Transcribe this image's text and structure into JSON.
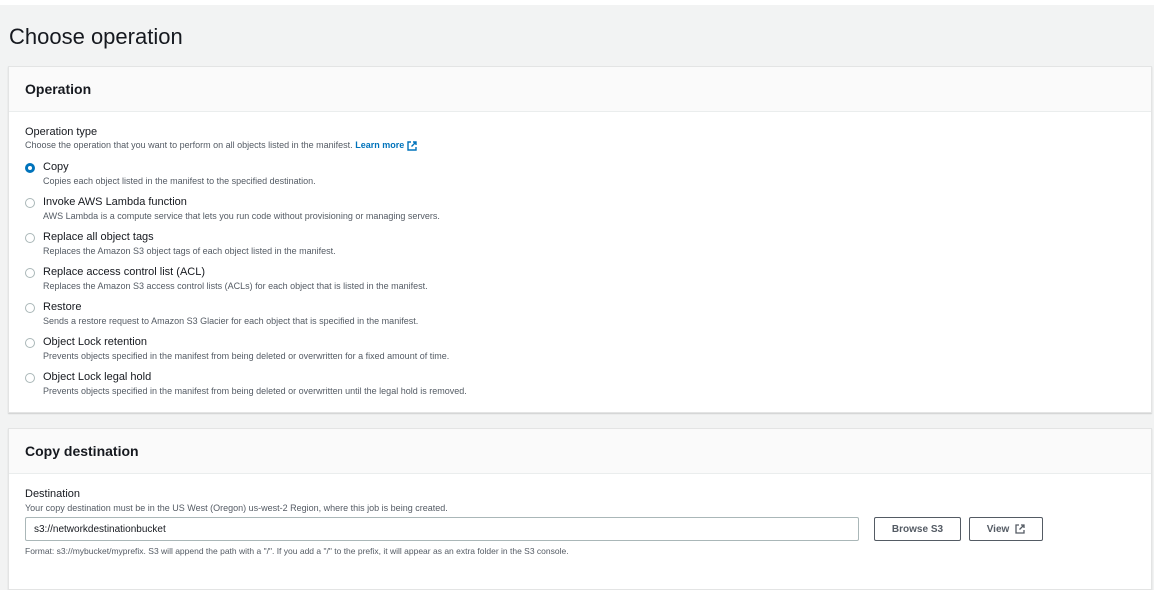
{
  "page": {
    "title": "Choose operation"
  },
  "operation": {
    "header": "Operation",
    "type_label": "Operation type",
    "type_desc": "Choose the operation that you want to perform on all objects listed in the manifest.",
    "learn_more": "Learn more",
    "selected": "copy",
    "options": [
      {
        "id": "copy",
        "label": "Copy",
        "desc": "Copies each object listed in the manifest to the specified destination."
      },
      {
        "id": "lambda",
        "label": "Invoke AWS Lambda function",
        "desc": "AWS Lambda is a compute service that lets you run code without provisioning or managing servers."
      },
      {
        "id": "tags",
        "label": "Replace all object tags",
        "desc": "Replaces the Amazon S3 object tags of each object listed in the manifest."
      },
      {
        "id": "acl",
        "label": "Replace access control list (ACL)",
        "desc": "Replaces the Amazon S3 access control lists (ACLs) for each object that is listed in the manifest."
      },
      {
        "id": "restore",
        "label": "Restore",
        "desc": "Sends a restore request to Amazon S3 Glacier for each object that is specified in the manifest."
      },
      {
        "id": "retention",
        "label": "Object Lock retention",
        "desc": "Prevents objects specified in the manifest from being deleted or overwritten for a fixed amount of time."
      },
      {
        "id": "legal",
        "label": "Object Lock legal hold",
        "desc": "Prevents objects specified in the manifest from being deleted or overwritten until the legal hold is removed."
      }
    ]
  },
  "destination": {
    "header": "Copy destination",
    "label": "Destination",
    "desc": "Your copy destination must be in the US West (Oregon) us-west-2 Region, where this job is being created.",
    "value": "s3://networkdestinationbucket",
    "browse_label": "Browse S3",
    "view_label": "View",
    "format_hint": "Format: s3://mybucket/myprefix. S3 will append the path with a \"/\". If you add a \"/\" to the prefix, it will appear as an extra folder in the S3 console."
  }
}
